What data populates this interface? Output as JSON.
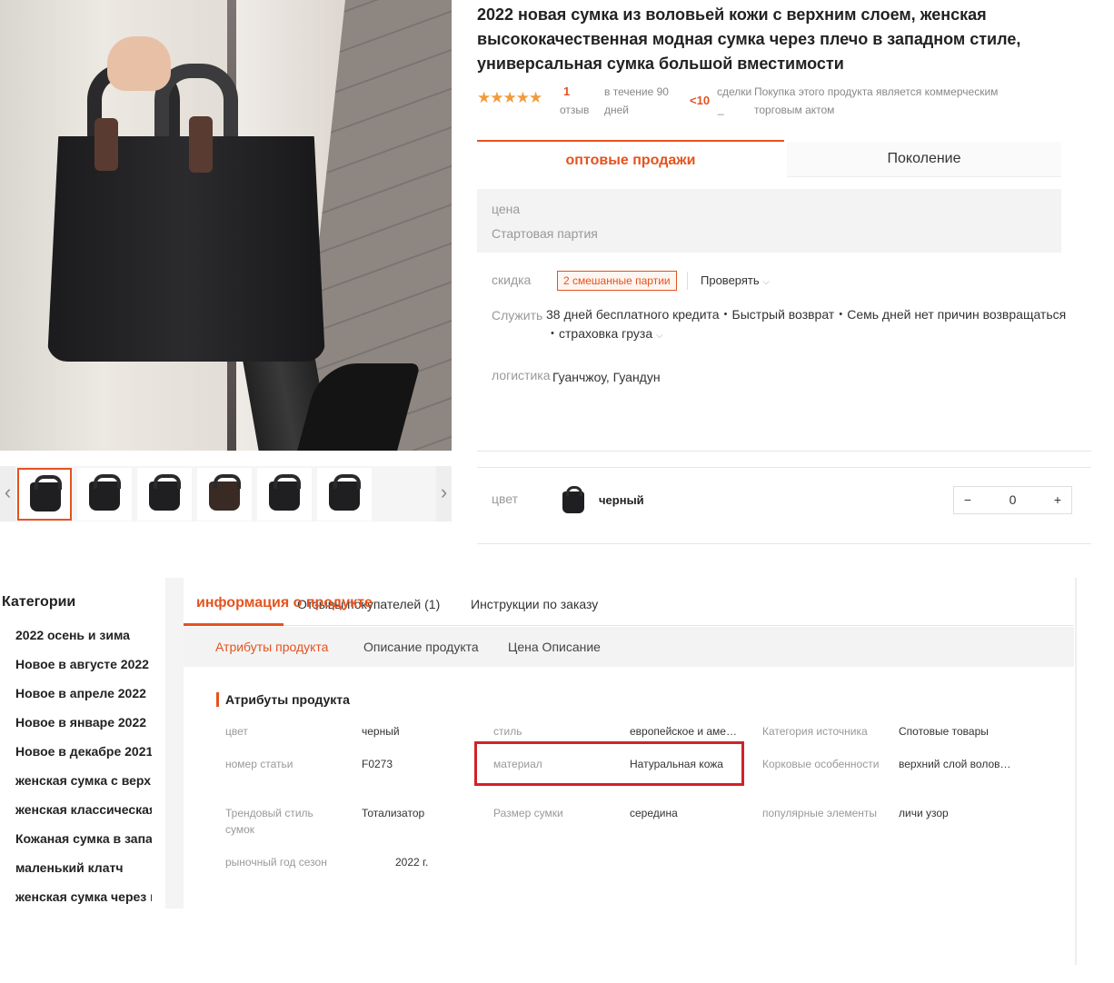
{
  "product": {
    "title": "2022 новая сумка из воловьей кожи с верхним слоем, женская высококачественная модная сумка через плечо в западном стиле, универсальная сумка большой вместимости",
    "rating_stars": "★★★★★",
    "reviews_count": "1",
    "reviews_label": "отзыв",
    "period_label": "в течение 90 дней",
    "deals_count": "<10",
    "deals_label": "сделки",
    "deals_sub": "_",
    "commercial_note": "Покупка этого продукта является коммерческим торговым актом"
  },
  "purchase_tabs": {
    "wholesale": "оптовые продажи",
    "generation": "Поколение"
  },
  "price_box": {
    "price_label": "цена",
    "batch_label": "Стартовая партия"
  },
  "discount": {
    "label": "скидка",
    "badge": "2 смешанные партии",
    "check": "Проверять"
  },
  "service": {
    "label": "Служить",
    "line1": "38 дней бесплатного кредита・Быстрый возврат・Семь дней нет причин возвращаться",
    "line2": "・страховка груза"
  },
  "logistics": {
    "label": "логистика",
    "value": "Гуанчжоу, Гуандун"
  },
  "color_option": {
    "label": "цвет",
    "name": "черный",
    "qty": "0",
    "minus": "−",
    "plus": "+"
  },
  "thumb_nav": {
    "prev": "‹",
    "next": "›"
  },
  "categories": {
    "title": "Категории",
    "items": [
      "2022 осень и зима",
      "Новое в августе 2022",
      "Новое в апреле 2022",
      "Новое в январе 2022",
      "Новое в декабре 2021",
      "женская сумка с верхней ручкой",
      "женская классическая сумка",
      "Кожаная сумка в западном стиле",
      "маленький клатч",
      "женская сумка через плечо"
    ]
  },
  "detail_tabs": {
    "info": "информация о продукте",
    "reviews": "Отзывы покупателей (1)",
    "instructions": "Инструкции по заказу"
  },
  "sub_tabs": {
    "attributes": "Атрибуты продукта",
    "description": "Описание продукта",
    "price_desc": "Цена Описание"
  },
  "attributes": {
    "heading": "Атрибуты продукта",
    "color_k": "цвет",
    "color_v": "черный",
    "style_k": "стиль",
    "style_v": "европейское и американское",
    "source_k": "Категория источника",
    "source_v": "Спотовые товары",
    "article_k": "номер статьи",
    "article_v": "F0273",
    "material_k": "материал",
    "material_v": "Натуральная кожа",
    "cork_k": "Корковые особенности",
    "cork_v": "верхний слой воловьей кожи",
    "trend_k": "Трендовый стиль сумок",
    "trend_v": "Тотализатор",
    "size_k": "Размер сумки",
    "size_v": "середина",
    "popular_k": "популярные элементы",
    "popular_v": "личи узор",
    "season_k": "рыночный год сезон",
    "season_v": "2022 г."
  },
  "colors": {
    "accent": "#e4531f",
    "highlight": "#d1222a",
    "stars": "#f29b3b"
  }
}
